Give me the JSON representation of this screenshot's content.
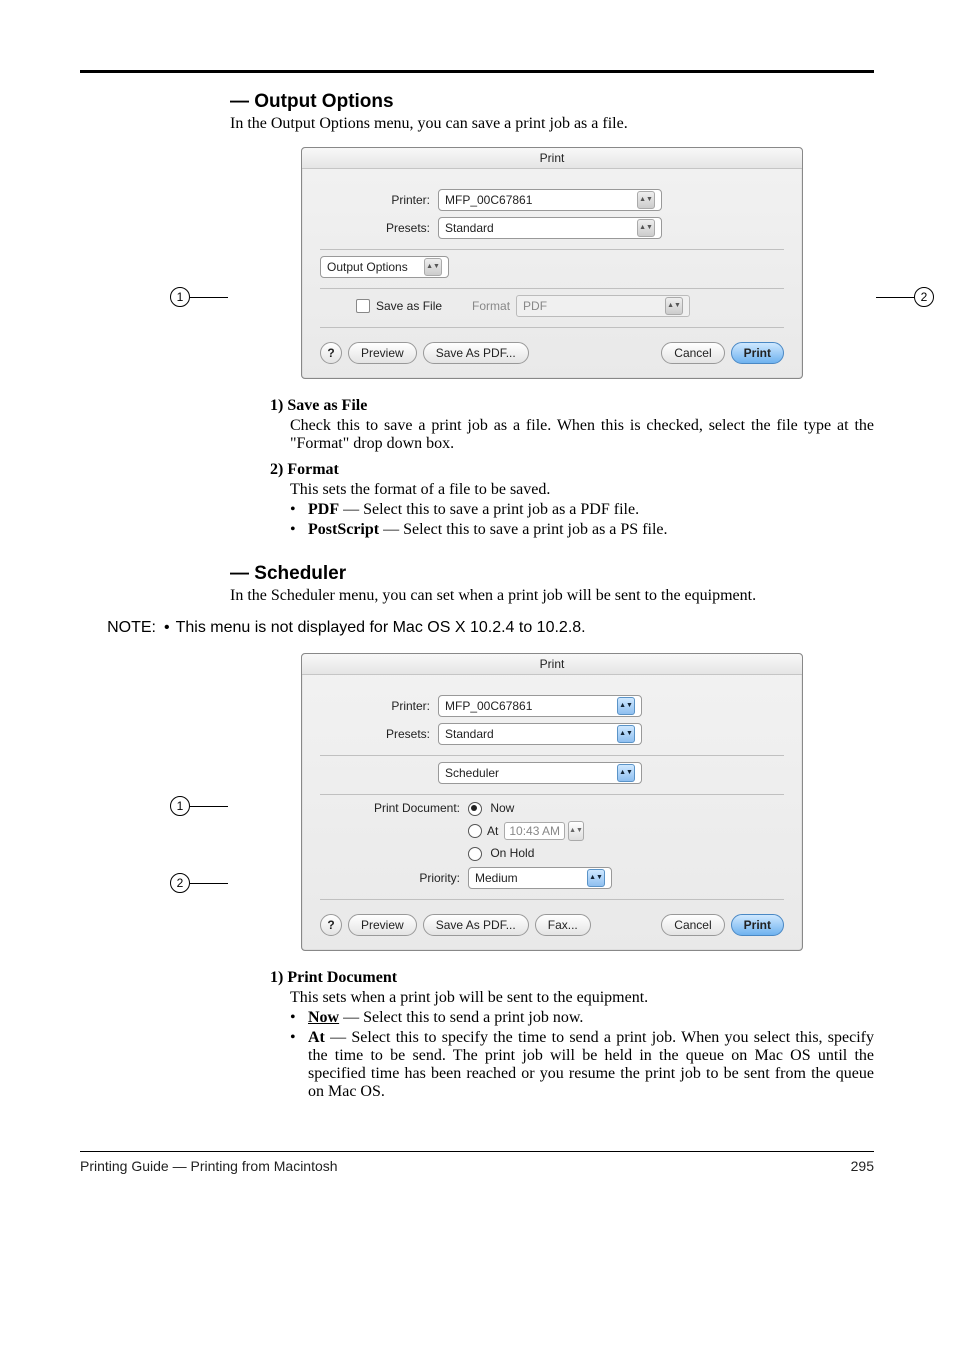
{
  "sections": {
    "output": {
      "heading": "— Output Options",
      "intro": "In the Output Options menu, you can save a print job as a file.",
      "items": [
        {
          "num": "1)",
          "title": "Save as File",
          "desc": "Check this to save a print job as a file.  When this is checked, select the file type at the \"Format\" drop down box."
        },
        {
          "num": "2)",
          "title": "Format",
          "desc": "This sets the format of a file to be saved.",
          "bullets": [
            {
              "term": "PDF",
              "text": " — Select this to save a print job as a PDF file."
            },
            {
              "term": "PostScript",
              "text": " — Select this to save a print job as a PS file."
            }
          ]
        }
      ]
    },
    "scheduler": {
      "heading": "— Scheduler",
      "intro": "In the Scheduler menu, you can set when a print job will be sent to the equipment.",
      "note_label": "NOTE:",
      "note_text": "This menu is not displayed for Mac OS X 10.2.4 to 10.2.8.",
      "items": [
        {
          "num": "1)",
          "title": "Print Document",
          "desc": "This sets when a print job will be sent to the equipment.",
          "bullets": [
            {
              "term": "Now",
              "term_underline": true,
              "text": " — Select this to send a print job now."
            },
            {
              "term": "At",
              "text": " — Select this to specify the time to send a print job.  When you select this, specify the time to be send.  The print job will be held in the queue on Mac OS until the specified time has been reached or you resume the print job to be sent from the queue on Mac OS."
            }
          ]
        }
      ]
    }
  },
  "dialog1": {
    "title": "Print",
    "printer_label": "Printer:",
    "printer_value": "MFP_00C67861",
    "presets_label": "Presets:",
    "presets_value": "Standard",
    "pane_value": "Output Options",
    "save_label": "Save as File",
    "format_label": "Format",
    "format_value": "PDF",
    "help": "?",
    "preview": "Preview",
    "savepdf": "Save As PDF...",
    "cancel": "Cancel",
    "print": "Print",
    "callout_left": "1",
    "callout_right": "2"
  },
  "dialog2": {
    "title": "Print",
    "printer_label": "Printer:",
    "printer_value": "MFP_00C67861",
    "presets_label": "Presets:",
    "presets_value": "Standard",
    "pane_value": "Scheduler",
    "pd_label": "Print Document:",
    "opt_now": "Now",
    "opt_at": "At",
    "at_time": "10:43 AM",
    "opt_hold": "On Hold",
    "priority_label": "Priority:",
    "priority_value": "Medium",
    "help": "?",
    "preview": "Preview",
    "savepdf": "Save As PDF...",
    "fax": "Fax...",
    "cancel": "Cancel",
    "print": "Print",
    "callout_1": "1",
    "callout_2": "2"
  },
  "footer": {
    "left": "Printing Guide — Printing from Macintosh",
    "right": "295"
  }
}
